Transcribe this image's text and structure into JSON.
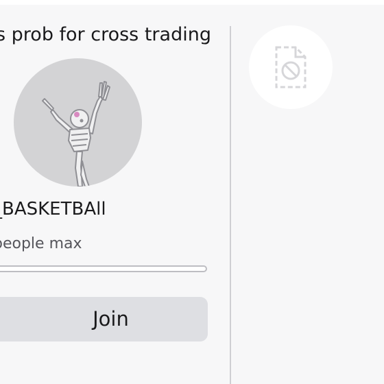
{
  "server": {
    "title": "s prob for cross trading",
    "player_name": "_BASKETBAll",
    "capacity_text": "people max",
    "fill_fraction": 0.0,
    "join_label": "Join"
  },
  "icons": {
    "avatar": "skeleton-avatar-icon",
    "placeholder": "broken-image-icon"
  }
}
